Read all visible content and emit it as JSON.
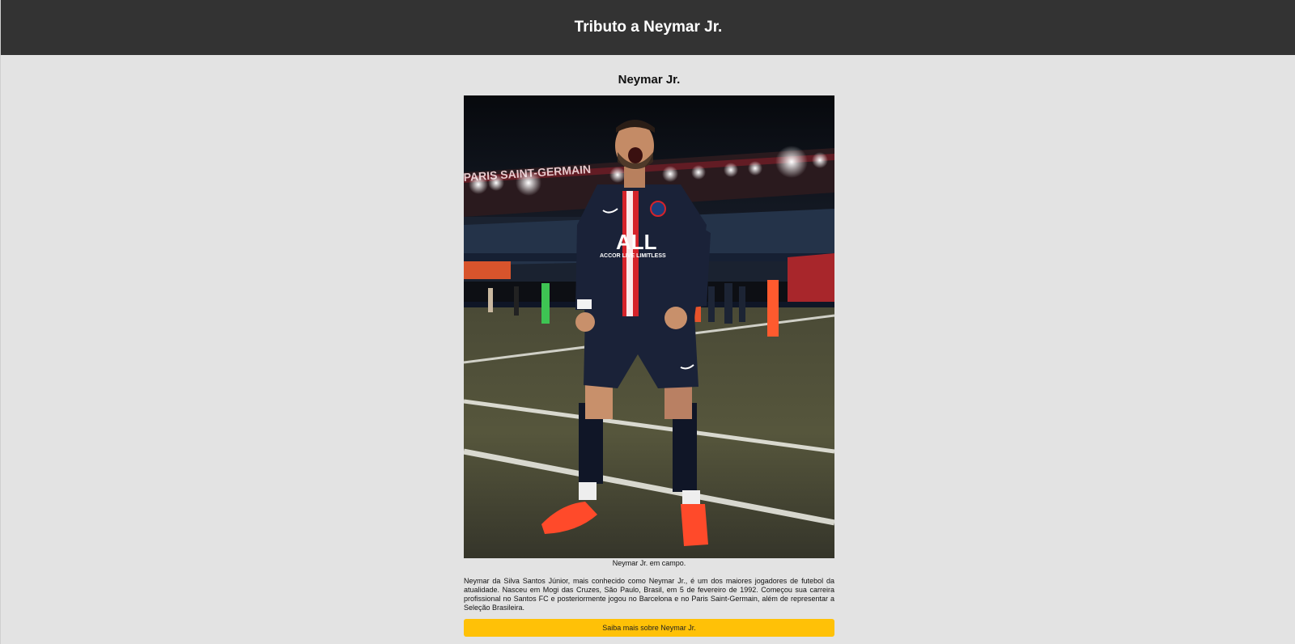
{
  "header": {
    "title": "Tributo a Neymar Jr."
  },
  "main": {
    "section_title": "Neymar Jr.",
    "image_caption": "Neymar Jr. em campo.",
    "bio": "Neymar da Silva Santos Júnior, mais conhecido como Neymar Jr., é um dos maiores jogadores de futebol da atualidade. Nasceu em Mogi das Cruzes, São Paulo, Brasil, em 5 de fevereiro de 1992. Começou sua carreira profissional no Santos FC e posteriormente jogou no Barcelona e no Paris Saint-Germain, além de representar a Seleção Brasileira.",
    "button_label": "Saiba mais sobre Neymar Jr."
  },
  "photo": {
    "stadium_banner": "PARIS SAINT-GERMAIN",
    "shirt_sponsor": "ALL",
    "shirt_sponsor_sub": "ACCOR LIVE LIMITLESS"
  },
  "colors": {
    "header_bg": "#333333",
    "page_bg": "#e3e3e3",
    "button_bg": "#ffc107",
    "kit_navy": "#1a2238",
    "kit_red": "#d5232a",
    "boots": "#ff4a2a"
  }
}
